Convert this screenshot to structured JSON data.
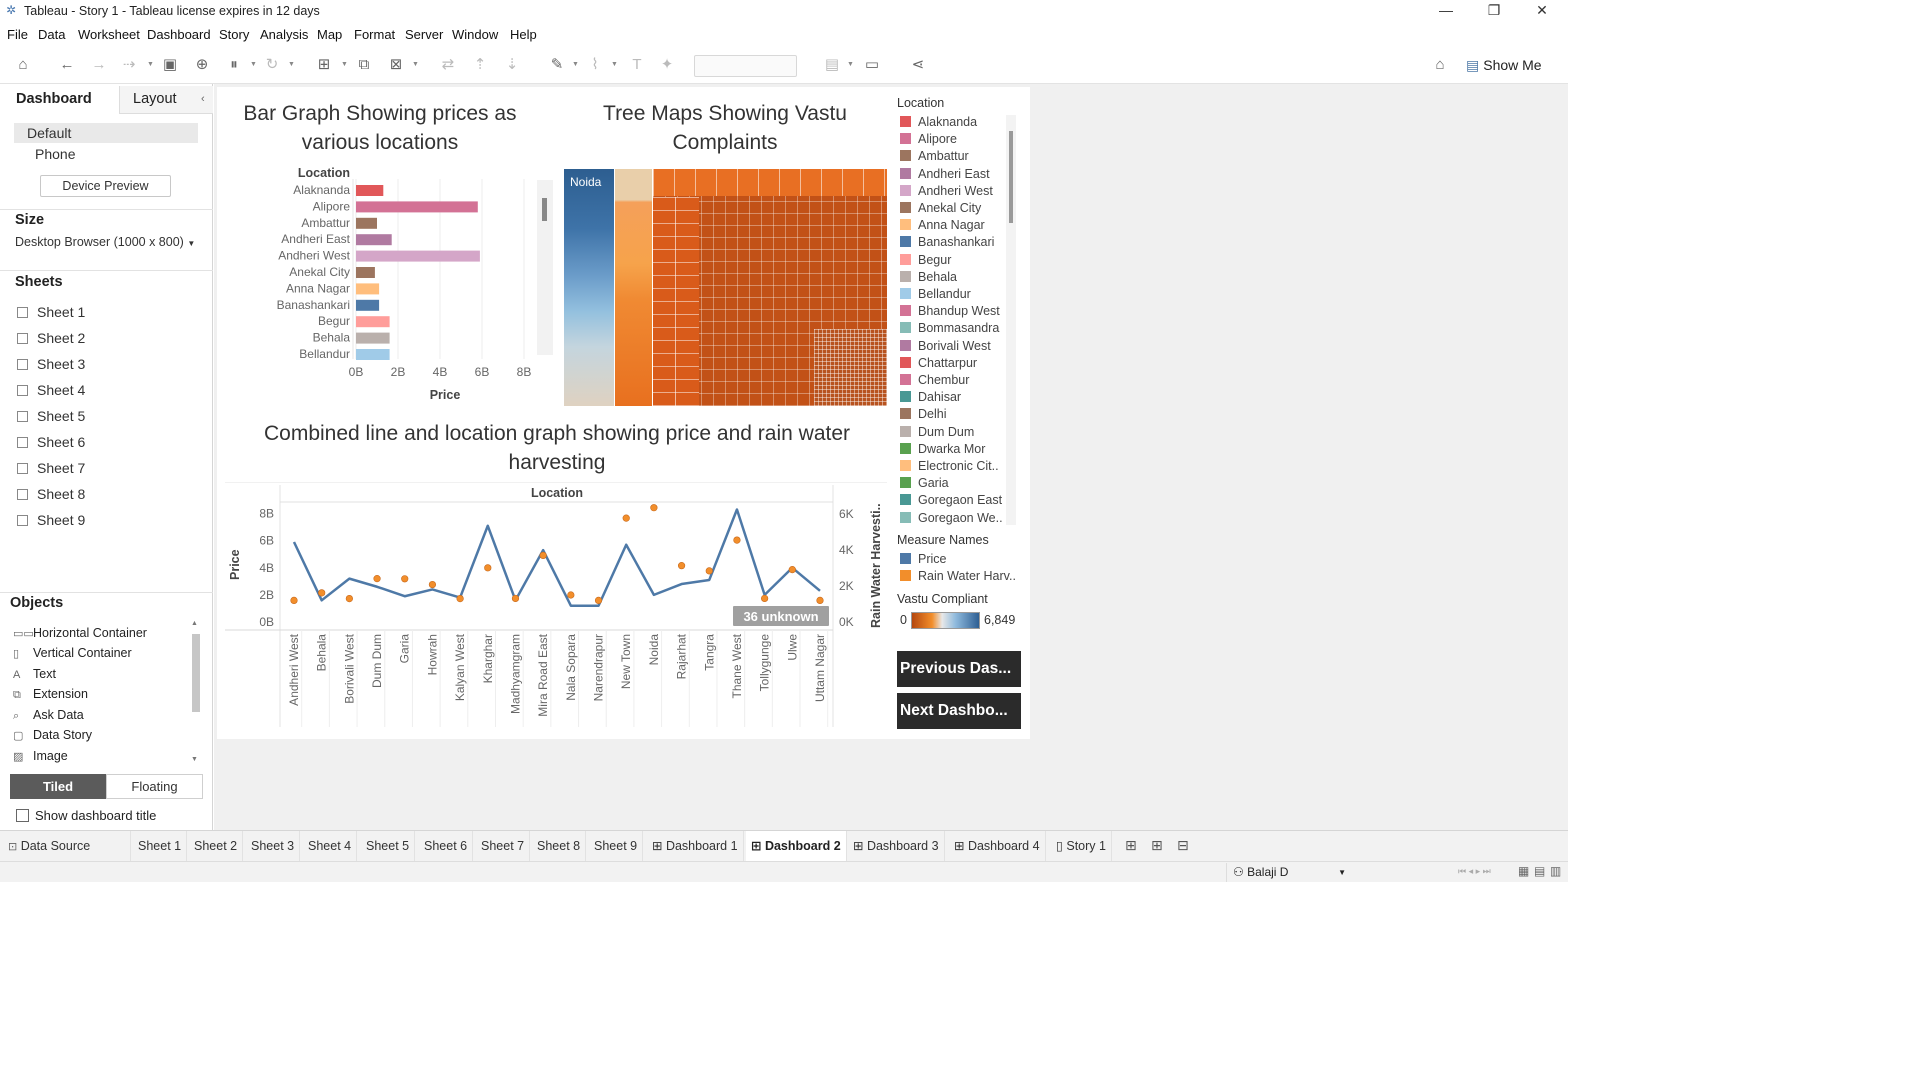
{
  "window": {
    "title": "Tableau - Story 1 - Tableau license expires in 12 days"
  },
  "menu": [
    "File",
    "Data",
    "Worksheet",
    "Dashboard",
    "Story",
    "Analysis",
    "Map",
    "Format",
    "Server",
    "Window",
    "Help"
  ],
  "toolbar": {
    "show_me": "Show Me"
  },
  "left_pane": {
    "tabs": {
      "dashboard": "Dashboard",
      "layout": "Layout"
    },
    "device": {
      "default": "Default",
      "phone": "Phone",
      "preview": "Device Preview"
    },
    "size": {
      "header": "Size",
      "value": "Desktop Browser (1000 x 800)"
    },
    "sheets": {
      "header": "Sheets",
      "items": [
        "Sheet 1",
        "Sheet 2",
        "Sheet 3",
        "Sheet 4",
        "Sheet 5",
        "Sheet 6",
        "Sheet 7",
        "Sheet 8",
        "Sheet 9"
      ]
    },
    "objects": {
      "header": "Objects",
      "items": [
        "Horizontal Container",
        "Vertical Container",
        "Text",
        "Extension",
        "Ask Data",
        "Data Story",
        "Image"
      ],
      "tiled": "Tiled",
      "floating": "Floating",
      "show_title": "Show dashboard title"
    }
  },
  "dashboard": {
    "bar_title": "Bar Graph Showing prices as various locations",
    "tree_title": "Tree Maps Showing Vastu Complaints",
    "tree_label": "Noida",
    "line_title": "Combined line and location graph showing price and rain water harvesting",
    "unknown_badge": "36 unknown",
    "prev_button": "Previous Das...",
    "next_button": "Next Dashbo..."
  },
  "legends": {
    "location": {
      "title": "Location",
      "items": [
        {
          "label": "Alaknanda",
          "color": "#e15759"
        },
        {
          "label": "Alipore",
          "color": "#d37295"
        },
        {
          "label": "Ambattur",
          "color": "#9c755f"
        },
        {
          "label": "Andheri East",
          "color": "#b07aa1"
        },
        {
          "label": "Andheri West",
          "color": "#d4a6c8"
        },
        {
          "label": "Anekal City",
          "color": "#9c755f"
        },
        {
          "label": "Anna Nagar",
          "color": "#ffbe7d"
        },
        {
          "label": "Banashankari",
          "color": "#4e79a7"
        },
        {
          "label": "Begur",
          "color": "#ff9d9a"
        },
        {
          "label": "Behala",
          "color": "#bab0ac"
        },
        {
          "label": "Bellandur",
          "color": "#a0cbe8"
        },
        {
          "label": "Bhandup West",
          "color": "#d37295"
        },
        {
          "label": "Bommasandra",
          "color": "#86bcb6"
        },
        {
          "label": "Borivali West",
          "color": "#b07aa1"
        },
        {
          "label": "Chattarpur",
          "color": "#e15759"
        },
        {
          "label": "Chembur",
          "color": "#d37295"
        },
        {
          "label": "Dahisar",
          "color": "#499894"
        },
        {
          "label": "Delhi",
          "color": "#9c755f"
        },
        {
          "label": "Dum Dum",
          "color": "#bab0ac"
        },
        {
          "label": "Dwarka Mor",
          "color": "#59a14f"
        },
        {
          "label": "Electronic Cit..",
          "color": "#ffbe7d"
        },
        {
          "label": "Garia",
          "color": "#59a14f"
        },
        {
          "label": "Goregaon East",
          "color": "#499894"
        },
        {
          "label": "Goregaon We..",
          "color": "#86bcb6"
        }
      ]
    },
    "measure": {
      "title": "Measure Names",
      "items": [
        {
          "label": "Price",
          "color": "#4e79a7"
        },
        {
          "label": "Rain Water Harv..",
          "color": "#f28e2b"
        }
      ]
    },
    "vastu": {
      "title": "Vastu Compliant",
      "min": "0",
      "max": "6,849"
    }
  },
  "chart_data": [
    {
      "type": "bar",
      "title": "Bar Graph Showing prices as various locations",
      "ylabel": "Location",
      "xlabel": "Price",
      "categories": [
        "Alaknanda",
        "Alipore",
        "Ambattur",
        "Andheri East",
        "Andheri West",
        "Anekal City",
        "Anna Nagar",
        "Banashankari",
        "Begur",
        "Behala",
        "Bellandur"
      ],
      "values": [
        1.3,
        5.8,
        1.0,
        1.7,
        5.9,
        0.9,
        1.1,
        1.1,
        1.6,
        1.6,
        1.6
      ],
      "colors": [
        "#e15759",
        "#d37295",
        "#9c755f",
        "#b07aa1",
        "#d4a6c8",
        "#9c755f",
        "#ffbe7d",
        "#4e79a7",
        "#ff9d9a",
        "#bab0ac",
        "#a0cbe8"
      ],
      "xticks": [
        "0B",
        "2B",
        "4B",
        "6B",
        "8B"
      ],
      "xlim": [
        0,
        8
      ]
    },
    {
      "type": "line",
      "title": "Combined line and location graph showing price and rain water harvesting",
      "xlabel": "Location",
      "ylabel": "Price",
      "y2label": "Rain Water Harvesti..",
      "categories": [
        "Andheri West",
        "Behala",
        "Borivali West",
        "Dum Dum",
        "Garia",
        "Howrah",
        "Kalyan West",
        "Kharghar",
        "Madhyamgram",
        "Mira Road East",
        "Nala Sopara",
        "Narendrapur",
        "New Town",
        "Noida",
        "Rajarhat",
        "Tangra",
        "Thane West",
        "Tollygunge",
        "Ulwe",
        "Uttam Nagar"
      ],
      "series": [
        {
          "name": "Price",
          "axis": "left",
          "values": [
            5.9,
            1.6,
            3.2,
            2.6,
            1.9,
            2.4,
            1.8,
            7.1,
            1.6,
            5.3,
            1.2,
            1.2,
            5.7,
            2.0,
            2.8,
            3.1,
            8.3,
            2.0,
            4.0,
            2.3
          ]
        },
        {
          "name": "Rain Water Harv..",
          "axis": "right",
          "values": [
            1200,
            1620,
            1300,
            2410,
            2400,
            2080,
            1300,
            3010,
            1310,
            3700,
            1500,
            1200,
            5770,
            6350,
            3130,
            2840,
            4550,
            1310,
            2910,
            1200
          ]
        }
      ],
      "yticks": [
        "0B",
        "2B",
        "4B",
        "6B",
        "8B"
      ],
      "ylim": [
        0,
        9
      ],
      "y2ticks": [
        "0K",
        "2K",
        "4K",
        "6K"
      ],
      "y2lim": [
        0,
        7000
      ]
    }
  ]
}
